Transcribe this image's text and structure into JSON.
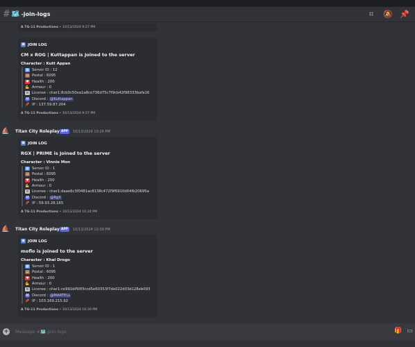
{
  "header": {
    "channel_icon": "🗺️",
    "channel_name": "-join-logs",
    "icons": [
      "threads-icon",
      "mute-icon",
      "pin-icon"
    ]
  },
  "partial_top": {
    "footer_org": "A TG-11 Productions",
    "footer_time": "10/13/2024 9:27 PM"
  },
  "messages": [
    {
      "show_header": false,
      "embed": {
        "author": "JOIN LOG",
        "title": "CM x ROG | Kuttappan is Joined to the server",
        "character": "Character : Kutt Appan",
        "server_id": "Server ID : 12",
        "postal": "Postal : 6095",
        "health": "Health : 200",
        "armour": "Armour : 0",
        "license": "License : char1:8cb0c50ea1a8ce736d75c7f9cb42f98333bafa16",
        "discord_label": "Discord : ",
        "discord_mention": "@Kuttappan",
        "ip": "IP : 137.59.87.204",
        "footer_org": "A TG-11 Productions",
        "footer_time": "10/13/2024 9:27 PM"
      }
    },
    {
      "show_header": true,
      "username": "Titan City Roleplay",
      "badge": "APP",
      "timestamp": "10/13/2024 10:24 PM",
      "embed": {
        "author": "JOIN LOG",
        "title": "RGX | PRIME is Joined to the server",
        "character": "Character : Vinnie Mon",
        "server_id": "Server ID : 1",
        "postal": "Postal : 6095",
        "health": "Health : 200",
        "armour": "Armour : 0",
        "license": "License : char1:daae6c3f0481ac8138c472f9f6910d04fb20695a",
        "discord_label": "Discord : ",
        "discord_mention": "@RgX",
        "ip": "IP : 59.93.28.165",
        "footer_org": "A TG-11 Productions",
        "footer_time": "10/13/2024 10:24 PM"
      }
    },
    {
      "show_header": true,
      "username": "Titan City Roleplay",
      "badge": "APP",
      "timestamp": "10/13/2024 10:39 PM",
      "embed": {
        "author": "JOIN LOG",
        "title": "moflo is Joined to the server",
        "character": "Character : Khal Drogo",
        "server_id": "Server ID : 1",
        "postal": "Postal : 6095",
        "health": "Health : 200",
        "armour": "Armour : 0",
        "license": "License : char1:ce991bf50f3ccd5e60353f7de022d03d128eb093",
        "discord_label": "Discord : ",
        "discord_mention": "@MARTELL",
        "ip": "IP : 103.169.215.92",
        "footer_org": "A TG-11 Productions",
        "footer_time": "10/13/2024 10:39 PM"
      }
    }
  ],
  "composer": {
    "placeholder": "Message #🗺️-join-logs"
  },
  "colors": {
    "background": "#313338",
    "embed": "#2b2d31",
    "app_badge": "#5865f2",
    "mention": "#3c4270"
  }
}
